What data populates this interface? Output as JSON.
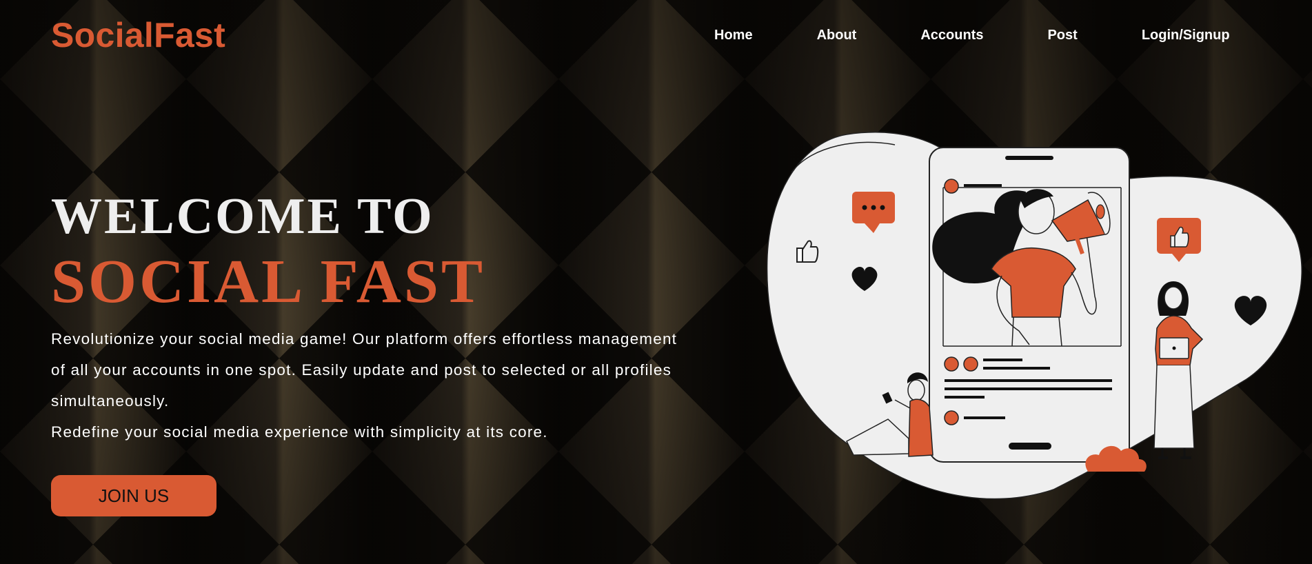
{
  "navbar": {
    "logo": "SocialFast",
    "links": [
      "Home",
      "About",
      "Accounts",
      "Post",
      "Login/Signup"
    ]
  },
  "hero": {
    "welcome": "WELCOME TO",
    "brand": "SOCIAL FAST",
    "description_lines": [
      "Revolutionize your social media game! Our platform offers effortless management",
      "of all your accounts in one spot. Easily update and post to selected or all profiles",
      "simultaneously.",
      "Redefine your social media experience with simplicity at its core."
    ],
    "join_button": "JOIN US"
  },
  "colors": {
    "accent": "#d95a33",
    "background": "#0c0a08",
    "illustration_bg": "#efefef"
  }
}
